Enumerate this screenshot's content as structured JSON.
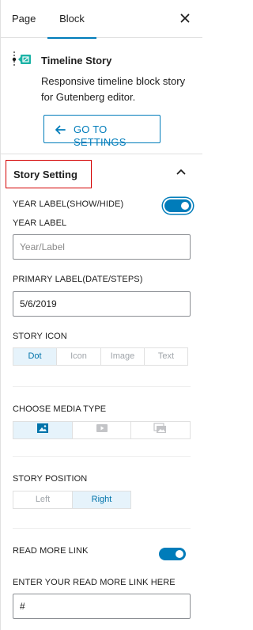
{
  "tabs": {
    "page_label": "Page",
    "block_label": "Block",
    "active": "Block"
  },
  "block": {
    "title": "Timeline Story",
    "description": "Responsive timeline block story for Gutenberg editor.",
    "goto_settings_label": "GO TO SETTINGS",
    "icon": "timeline-block-icon"
  },
  "section": {
    "title": "Story Setting",
    "expanded": true
  },
  "fields": {
    "year_label_toggle": {
      "label": "YEAR LABEL(SHOW/HIDE)",
      "on": true
    },
    "year_label": {
      "label": "YEAR LABEL",
      "placeholder": "Year/Label",
      "value": ""
    },
    "primary_label": {
      "label": "PRIMARY LABEL(DATE/STEPS)",
      "value": "5/6/2019"
    },
    "story_icon": {
      "label": "STORY ICON",
      "options": [
        "Dot",
        "Icon",
        "Image",
        "Text"
      ],
      "selected": "Dot"
    },
    "media_type": {
      "label": "CHOOSE MEDIA TYPE",
      "options": [
        "image-icon",
        "video-icon",
        "gallery-icon"
      ],
      "selected": "image-icon"
    },
    "story_position": {
      "label": "STORY POSITION",
      "options": [
        "Left",
        "Right"
      ],
      "selected": "Right"
    },
    "read_more_toggle": {
      "label": "READ MORE LINK",
      "on": true
    },
    "read_more_link": {
      "label": "ENTER YOUR READ MORE LINK HERE",
      "value": "#"
    }
  },
  "colors": {
    "accent": "#007cba",
    "highlight_border": "#d40000",
    "active_segment_bg": "#e6f3fb"
  }
}
